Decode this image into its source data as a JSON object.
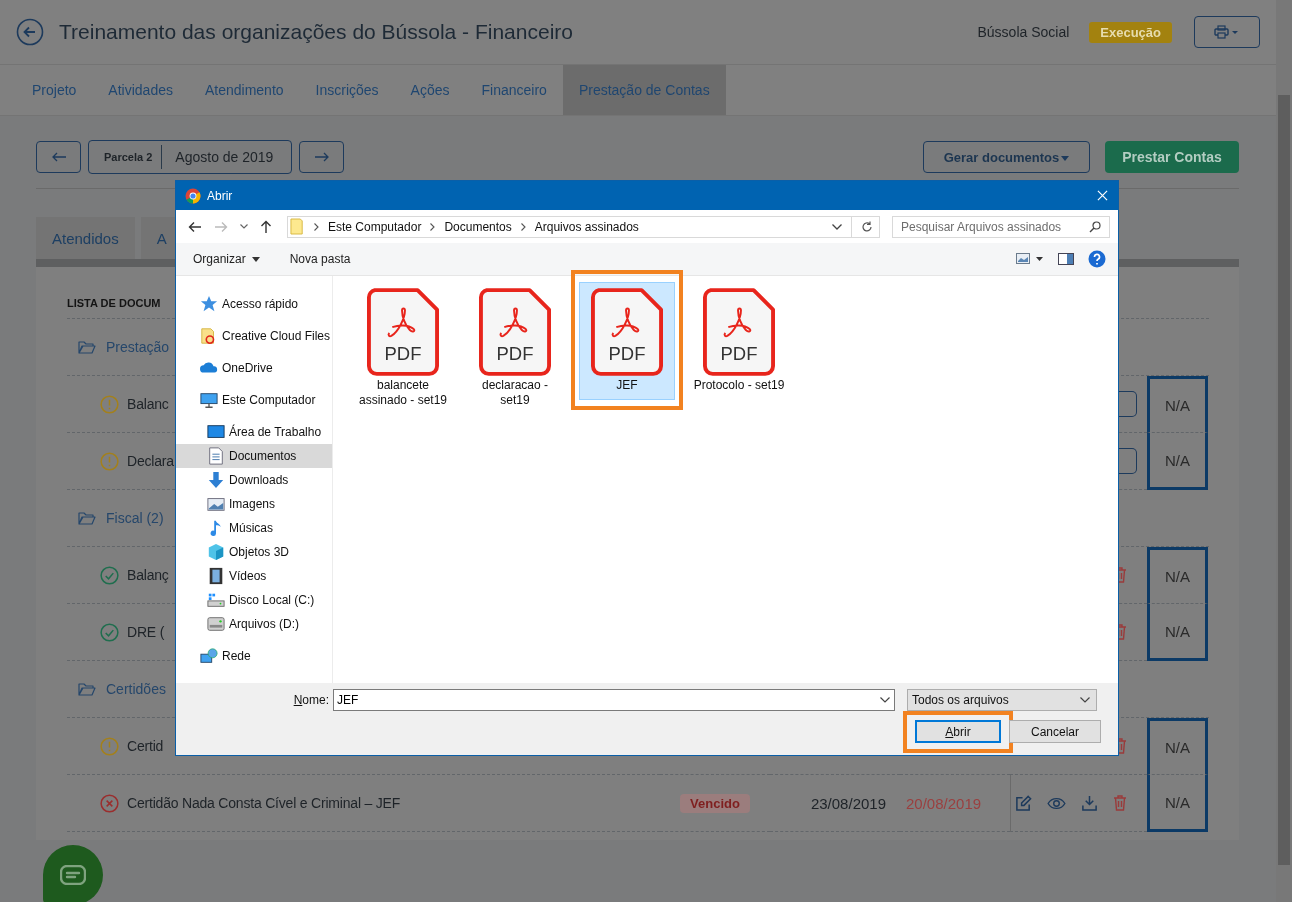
{
  "header": {
    "title": "Treinamento das organizações do Bússola - Financeiro",
    "organization": "Bússola Social",
    "status": "Execução"
  },
  "tabs": [
    {
      "label": "Projeto",
      "selected": false
    },
    {
      "label": "Atividades",
      "selected": false
    },
    {
      "label": "Atendimento",
      "selected": false
    },
    {
      "label": "Inscrições",
      "selected": false
    },
    {
      "label": "Ações",
      "selected": false
    },
    {
      "label": "Financeiro",
      "selected": false
    },
    {
      "label": "Prestação de Contas",
      "selected": true
    }
  ],
  "period": {
    "installment": "Parcela 2",
    "month": "Agosto de 2019"
  },
  "actions": [
    {
      "label": "Gerar documentos",
      "kind": "dropdown"
    },
    {
      "label": "Prestar Contas",
      "kind": "primary"
    }
  ],
  "subtabs": [
    {
      "label": "Atendidos",
      "selected": false
    },
    {
      "label": "A",
      "selected": false
    }
  ],
  "documents": {
    "heading": "LISTA DE DOCUM",
    "groups": [
      {
        "name": "Prestação",
        "kind": "upload",
        "items": [
          {
            "name": "Balanc",
            "kind": "warning",
            "na": "N/A"
          },
          {
            "name": "Declara",
            "kind": "warning",
            "na": "N/A"
          }
        ]
      },
      {
        "name": "Fiscal (2)",
        "kind": "files",
        "items": [
          {
            "name": "Balanç",
            "kind": "ok",
            "na": "N/A"
          },
          {
            "name": "DRE (",
            "kind": "ok",
            "na": "N/A"
          }
        ]
      },
      {
        "name": "Certidões",
        "kind": "files",
        "items": [
          {
            "name": "Certid",
            "kind": "warning",
            "na": "N/A"
          },
          {
            "name": "Certidão Nada Consta Cível e Criminal – JEF",
            "kind": "error",
            "badge": "Vencido",
            "date": "23/08/2019",
            "due_date": "20/08/2019",
            "na": "N/A"
          }
        ]
      }
    ]
  },
  "dialog": {
    "title": "Abrir",
    "path": [
      "Este Computador",
      "Documentos",
      "Arquivos assinados"
    ],
    "search_placeholder": "Pesquisar Arquivos assinados",
    "toolbar": [
      "Organizar",
      "Nova pasta"
    ],
    "nav": [
      {
        "label": "Acesso rápido",
        "selected": false
      },
      {
        "label": "Creative Cloud Files",
        "selected": false
      },
      {
        "label": "OneDrive",
        "selected": false
      },
      {
        "label": "Este Computador",
        "selected": false,
        "children": [
          {
            "label": "Área de Trabalho",
            "selected": false
          },
          {
            "label": "Documentos",
            "selected": true
          },
          {
            "label": "Downloads",
            "selected": false
          },
          {
            "label": "Imagens",
            "selected": false
          },
          {
            "label": "Músicas",
            "selected": false
          },
          {
            "label": "Objetos 3D",
            "selected": false
          },
          {
            "label": "Vídeos",
            "selected": false
          },
          {
            "label": "Disco Local (C:)",
            "selected": false
          },
          {
            "label": "Arquivos (D:)",
            "selected": false
          }
        ]
      },
      {
        "label": "Rede",
        "selected": false
      }
    ],
    "files": [
      {
        "name": "balancete assinado - set19",
        "icon_text": "PDF",
        "selected": false,
        "highlighted": false
      },
      {
        "name": "declaracao - set19",
        "icon_text": "PDF",
        "selected": false,
        "highlighted": false
      },
      {
        "name": "JEF",
        "icon_text": "PDF",
        "selected": true,
        "highlighted": true
      },
      {
        "name": "Protocolo - set19",
        "icon_text": "PDF",
        "selected": false,
        "highlighted": false
      }
    ],
    "filename_label": "Nome:",
    "filename": "JEF",
    "filetype": "Todos os arquivos",
    "buttons": [
      {
        "label": "Abrir",
        "kind": "primary",
        "highlighted": true
      },
      {
        "label": "Cancelar",
        "kind": "secondary",
        "highlighted": false
      }
    ]
  }
}
